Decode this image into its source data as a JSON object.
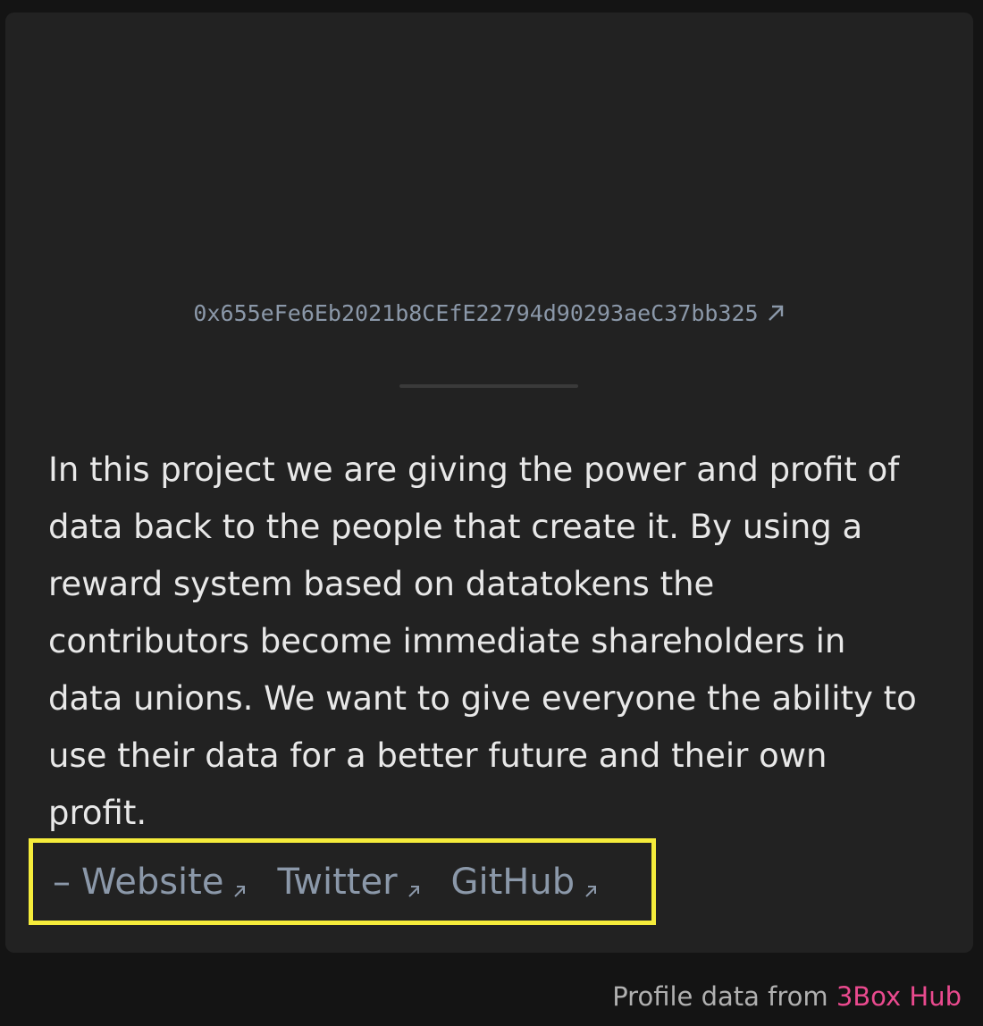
{
  "profile": {
    "address": "0x655eFe6Eb2021b8CEfE22794d90293aeC37bb325",
    "description": "In this project we are giving the power and profit of data back to the people that create it. By using a reward system based on datatokens the contributors become immediate shareholders in data unions. We want to give everyone the ability to use their data for a better future and their own profit.",
    "links_prefix": "–",
    "links": [
      {
        "label": "Website"
      },
      {
        "label": "Twitter"
      },
      {
        "label": "GitHub"
      }
    ]
  },
  "footer": {
    "text": "Profile data from",
    "link_label": "3Box Hub",
    "link_color": "#e94a8e"
  },
  "colors": {
    "background": "#141414",
    "card": "#222222",
    "muted_text": "#8b98a9",
    "body_text": "#e8e8e8",
    "highlight_border": "#f5ec3b"
  },
  "icons": {
    "external_link": "arrow-up-right-icon"
  }
}
